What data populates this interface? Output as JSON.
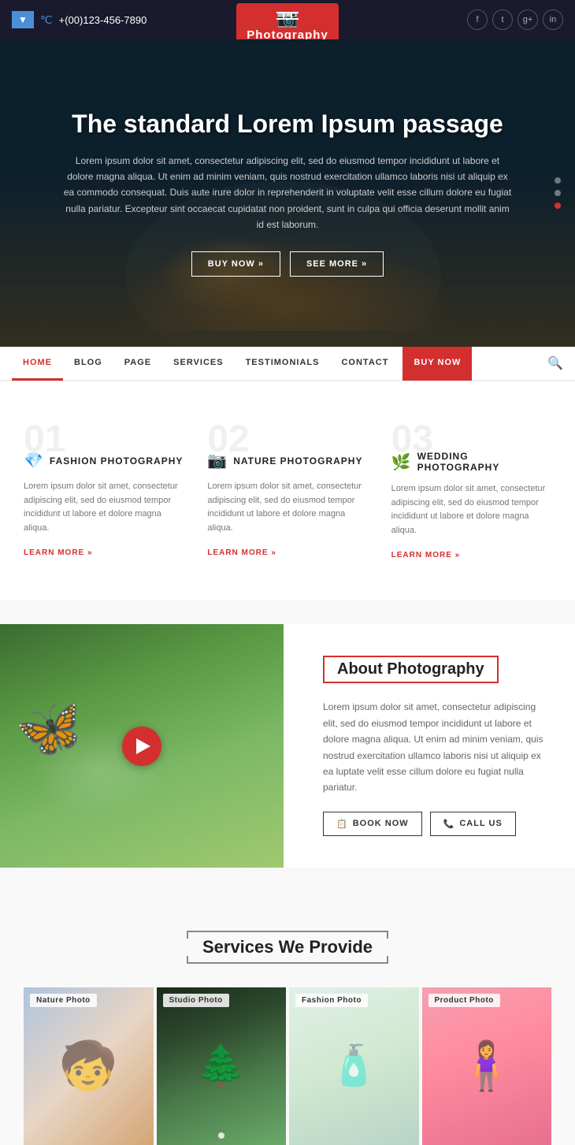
{
  "topbar": {
    "lang": "▼",
    "phone_icon": "℃",
    "phone": "+(00)123-456-7890",
    "social": [
      "f",
      "t",
      "g+",
      "in"
    ]
  },
  "logo": {
    "text": "Photography",
    "camera": "📷"
  },
  "hero": {
    "title": "The standard Lorem Ipsum passage",
    "desc": "Lorem ipsum dolor sit amet, consectetur adipiscing elit, sed do eiusmod tempor incididunt ut labore et dolore magna aliqua. Ut enim ad minim veniam, quis nostrud exercitation ullamco laboris nisi ut aliquip ex ea commodo consequat. Duis aute irure dolor in reprehenderit in voluptate velit esse cillum dolore eu fugiat nulla pariatur. Excepteur sint occaecat cupidatat non proident, sunt in culpa qui officia deserunt mollit anim id est laborum.",
    "btn1": "BUY NOW »",
    "btn2": "SEE MORE »"
  },
  "nav": {
    "items": [
      {
        "label": "HOME",
        "active": true
      },
      {
        "label": "BLOG",
        "active": false
      },
      {
        "label": "PAGE",
        "active": false
      },
      {
        "label": "SERVICES",
        "active": false
      },
      {
        "label": "TESTIMONIALS",
        "active": false
      },
      {
        "label": "CONTACT",
        "active": false
      },
      {
        "label": "BUY NOW",
        "active": false,
        "special": true
      }
    ]
  },
  "services": {
    "items": [
      {
        "num": "01",
        "icon": "💎",
        "title": "FASHION PHOTOGRAPHY",
        "desc": "Lorem ipsum dolor sit amet, consectetur adipiscing elit, sed do eiusmod tempor incididunt ut labore et dolore magna aliqua.",
        "link": "LEARN MORE »"
      },
      {
        "num": "02",
        "icon": "📷",
        "title": "NATURE PHOTOGRAPHY",
        "desc": "Lorem ipsum dolor sit amet, consectetur adipiscing elit, sed do eiusmod tempor incididunt ut labore et dolore magna aliqua.",
        "link": "LEARN MORE »"
      },
      {
        "num": "03",
        "icon": "🌿",
        "title": "WEDDING PHOTOGRAPHY",
        "desc": "Lorem ipsum dolor sit amet, consectetur adipiscing elit, sed do eiusmod tempor incididunt ut labore et dolore magna aliqua.",
        "link": "LEARN MORE »"
      }
    ]
  },
  "about": {
    "title": "About Photography",
    "desc": "Lorem ipsum dolor sit amet, consectetur adipiscing elit, sed do eiusmod tempor incididunt ut labore et dolore magna aliqua. Ut enim ad minim veniam, quis nostrud exercitation ullamco laboris nisi ut aliquip ex ea luptate velit esse cillum dolore eu fugiat nulla pariatur.",
    "btn_book": "BOOK NOW",
    "btn_call": "CALL US",
    "book_icon": "📋",
    "call_icon": "📞"
  },
  "provide": {
    "title": "Services We Provide",
    "photos": [
      {
        "label": "Nature Photo",
        "type": "nature"
      },
      {
        "label": "Studio Photo",
        "type": "studio"
      },
      {
        "label": "Fashion Photo",
        "type": "fashion"
      },
      {
        "label": "Product Photo",
        "type": "product"
      }
    ]
  }
}
